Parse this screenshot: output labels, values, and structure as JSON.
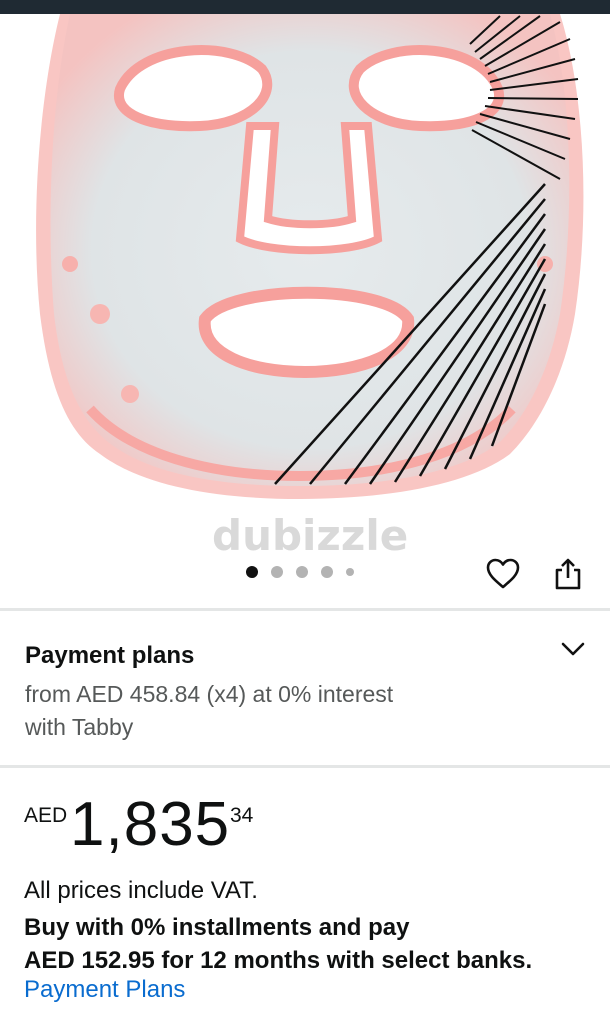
{
  "gallery": {
    "watermark": "dubizzle",
    "image_count": 5,
    "active_index": 0
  },
  "actions": {
    "favorite_icon": "heart-icon",
    "share_icon": "share-icon"
  },
  "payment_plans": {
    "title": "Payment plans",
    "line1": "from AED 458.84 (x4) at 0% interest",
    "line2": "with Tabby",
    "toggle_icon": "chevron-down-icon"
  },
  "price": {
    "currency": "AED",
    "whole": "1,835",
    "fraction": "34"
  },
  "info": {
    "vat": "All prices include VAT.",
    "installments_line1": "Buy with 0% installments and pay",
    "installments_line2": "AED 152.95 for 12 months with select banks.",
    "link": "Payment Plans"
  },
  "colors": {
    "link": "#0a6ccf",
    "mask_glow": "#f8a9a6",
    "mask_body": "#e3e8ea"
  }
}
